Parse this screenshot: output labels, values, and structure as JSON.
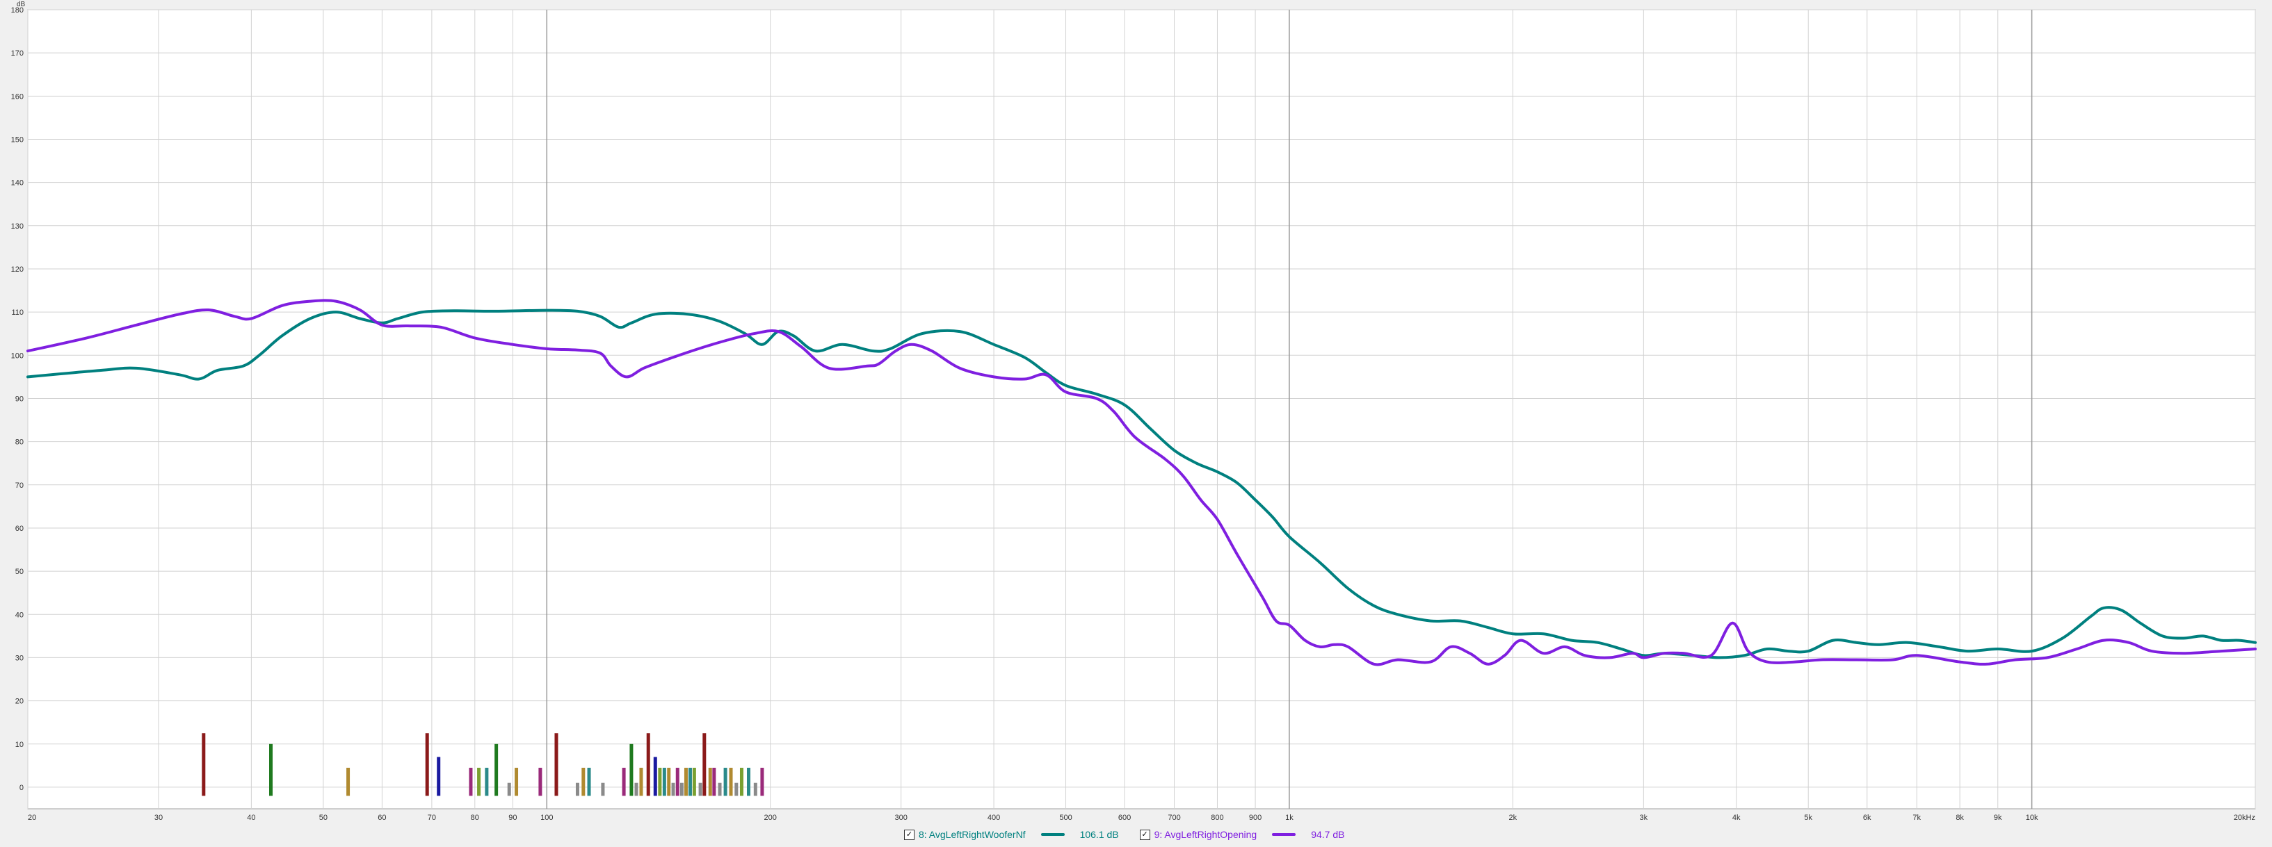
{
  "chart_data": {
    "type": "line",
    "title": "",
    "xlabel": "",
    "ylabel": "dB",
    "x_scale": "log",
    "xlim": [
      20,
      20000
    ],
    "ylim": [
      -5,
      180
    ],
    "grid": true,
    "y_ticks": [
      0,
      10,
      20,
      30,
      40,
      50,
      60,
      70,
      80,
      90,
      100,
      110,
      120,
      130,
      140,
      150,
      160,
      170,
      180
    ],
    "x_ticks": [
      {
        "value": 20,
        "label": "20"
      },
      {
        "value": 30,
        "label": "30"
      },
      {
        "value": 40,
        "label": "40"
      },
      {
        "value": 50,
        "label": "50"
      },
      {
        "value": 60,
        "label": "60"
      },
      {
        "value": 70,
        "label": "70"
      },
      {
        "value": 80,
        "label": "80"
      },
      {
        "value": 90,
        "label": "90"
      },
      {
        "value": 100,
        "label": "100"
      },
      {
        "value": 200,
        "label": "200"
      },
      {
        "value": 300,
        "label": "300"
      },
      {
        "value": 400,
        "label": "400"
      },
      {
        "value": 500,
        "label": "500"
      },
      {
        "value": 600,
        "label": "600"
      },
      {
        "value": 700,
        "label": "700"
      },
      {
        "value": 800,
        "label": "800"
      },
      {
        "value": 900,
        "label": "900"
      },
      {
        "value": 1000,
        "label": "1k"
      },
      {
        "value": 2000,
        "label": "2k"
      },
      {
        "value": 3000,
        "label": "3k"
      },
      {
        "value": 4000,
        "label": "4k"
      },
      {
        "value": 5000,
        "label": "5k"
      },
      {
        "value": 6000,
        "label": "6k"
      },
      {
        "value": 7000,
        "label": "7k"
      },
      {
        "value": 8000,
        "label": "8k"
      },
      {
        "value": 9000,
        "label": "9k"
      },
      {
        "value": 10000,
        "label": "10k"
      },
      {
        "value": 20000,
        "label": "20kHz"
      }
    ],
    "series": [
      {
        "name": "8: AvgLeftRightWooferNf",
        "level": "106.1 dB",
        "color": "#00807f",
        "points": [
          [
            20,
            95
          ],
          [
            25,
            96.5
          ],
          [
            28,
            97
          ],
          [
            32,
            95.5
          ],
          [
            34,
            94.5
          ],
          [
            36,
            96.5
          ],
          [
            39,
            97.5
          ],
          [
            41,
            100
          ],
          [
            44,
            104.5
          ],
          [
            48,
            108.5
          ],
          [
            52,
            110
          ],
          [
            56,
            108.5
          ],
          [
            60,
            107.5
          ],
          [
            63,
            108.5
          ],
          [
            68,
            110
          ],
          [
            75,
            110.3
          ],
          [
            85,
            110.2
          ],
          [
            100,
            110.4
          ],
          [
            110,
            110.2
          ],
          [
            118,
            109
          ],
          [
            125,
            106.5
          ],
          [
            130,
            107.5
          ],
          [
            140,
            109.5
          ],
          [
            155,
            109.5
          ],
          [
            170,
            108
          ],
          [
            185,
            105
          ],
          [
            195,
            102.5
          ],
          [
            205,
            105.5
          ],
          [
            215,
            104.5
          ],
          [
            230,
            101
          ],
          [
            250,
            102.5
          ],
          [
            275,
            101
          ],
          [
            290,
            101.5
          ],
          [
            320,
            105
          ],
          [
            360,
            105.5
          ],
          [
            400,
            102.5
          ],
          [
            440,
            99.5
          ],
          [
            470,
            96
          ],
          [
            500,
            93
          ],
          [
            550,
            91
          ],
          [
            600,
            88.5
          ],
          [
            650,
            83
          ],
          [
            700,
            78
          ],
          [
            750,
            75
          ],
          [
            800,
            73
          ],
          [
            850,
            70.5
          ],
          [
            900,
            66.5
          ],
          [
            950,
            62.5
          ],
          [
            1000,
            58
          ],
          [
            1100,
            52
          ],
          [
            1200,
            46
          ],
          [
            1300,
            42
          ],
          [
            1400,
            40
          ],
          [
            1550,
            38.5
          ],
          [
            1700,
            38.5
          ],
          [
            1850,
            37
          ],
          [
            2000,
            35.5
          ],
          [
            2200,
            35.5
          ],
          [
            2400,
            34
          ],
          [
            2600,
            33.5
          ],
          [
            2800,
            32
          ],
          [
            3000,
            30.5
          ],
          [
            3200,
            31
          ],
          [
            3500,
            30.5
          ],
          [
            3800,
            30
          ],
          [
            4100,
            30.5
          ],
          [
            4400,
            32
          ],
          [
            4700,
            31.5
          ],
          [
            5000,
            31.5
          ],
          [
            5400,
            34
          ],
          [
            5800,
            33.5
          ],
          [
            6200,
            33
          ],
          [
            6800,
            33.5
          ],
          [
            7500,
            32.5
          ],
          [
            8200,
            31.5
          ],
          [
            9000,
            32
          ],
          [
            10000,
            31.5
          ],
          [
            11000,
            34.5
          ],
          [
            12000,
            39.5
          ],
          [
            12500,
            41.5
          ],
          [
            13200,
            41
          ],
          [
            14000,
            38
          ],
          [
            15000,
            35
          ],
          [
            16000,
            34.5
          ],
          [
            17000,
            35
          ],
          [
            18000,
            34
          ],
          [
            19000,
            34
          ],
          [
            20000,
            33.5
          ]
        ]
      },
      {
        "name": "9: AvgLeftRightOpening",
        "level": "94.7 dB",
        "color": "#7f1fe0",
        "points": [
          [
            20,
            101
          ],
          [
            24,
            104
          ],
          [
            28,
            107
          ],
          [
            32,
            109.5
          ],
          [
            35,
            110.5
          ],
          [
            38,
            109
          ],
          [
            40,
            108.5
          ],
          [
            44,
            111.5
          ],
          [
            48,
            112.5
          ],
          [
            52,
            112.5
          ],
          [
            56,
            110.5
          ],
          [
            60,
            107
          ],
          [
            65,
            106.8
          ],
          [
            72,
            106.5
          ],
          [
            80,
            104
          ],
          [
            90,
            102.5
          ],
          [
            100,
            101.5
          ],
          [
            110,
            101.2
          ],
          [
            118,
            100.5
          ],
          [
            122,
            97.5
          ],
          [
            128,
            95
          ],
          [
            135,
            97
          ],
          [
            145,
            99
          ],
          [
            160,
            101.5
          ],
          [
            175,
            103.5
          ],
          [
            190,
            105
          ],
          [
            205,
            105.5
          ],
          [
            220,
            102
          ],
          [
            240,
            97
          ],
          [
            270,
            97.5
          ],
          [
            280,
            98
          ],
          [
            295,
            101
          ],
          [
            310,
            102.5
          ],
          [
            330,
            101
          ],
          [
            360,
            97
          ],
          [
            400,
            95
          ],
          [
            440,
            94.5
          ],
          [
            470,
            95.5
          ],
          [
            500,
            91.5
          ],
          [
            550,
            90
          ],
          [
            580,
            87
          ],
          [
            620,
            81
          ],
          [
            680,
            76
          ],
          [
            720,
            72
          ],
          [
            760,
            66.5
          ],
          [
            800,
            62
          ],
          [
            850,
            54
          ],
          [
            920,
            44
          ],
          [
            960,
            38.5
          ],
          [
            1000,
            37.5
          ],
          [
            1050,
            34
          ],
          [
            1100,
            32.5
          ],
          [
            1150,
            33
          ],
          [
            1200,
            32.5
          ],
          [
            1300,
            28.5
          ],
          [
            1400,
            29.5
          ],
          [
            1550,
            29
          ],
          [
            1650,
            32.5
          ],
          [
            1750,
            31
          ],
          [
            1850,
            28.5
          ],
          [
            1950,
            30.5
          ],
          [
            2050,
            34
          ],
          [
            2200,
            31
          ],
          [
            2350,
            32.5
          ],
          [
            2500,
            30.5
          ],
          [
            2700,
            30
          ],
          [
            2900,
            31
          ],
          [
            3000,
            30
          ],
          [
            3200,
            31
          ],
          [
            3400,
            31
          ],
          [
            3700,
            30.5
          ],
          [
            3950,
            38
          ],
          [
            4150,
            31.5
          ],
          [
            4400,
            29
          ],
          [
            4800,
            29
          ],
          [
            5200,
            29.5
          ],
          [
            5800,
            29.5
          ],
          [
            6500,
            29.5
          ],
          [
            7000,
            30.5
          ],
          [
            8000,
            29
          ],
          [
            8700,
            28.5
          ],
          [
            9500,
            29.5
          ],
          [
            10500,
            30
          ],
          [
            11500,
            32
          ],
          [
            12500,
            34
          ],
          [
            13500,
            33.5
          ],
          [
            14500,
            31.5
          ],
          [
            16000,
            31
          ],
          [
            18000,
            31.5
          ],
          [
            20000,
            32
          ]
        ]
      }
    ],
    "marker_bars": [
      {
        "freq": 34.5,
        "value": 12.5,
        "color": "#8b1a1a"
      },
      {
        "freq": 42.5,
        "value": 10,
        "color": "#1f7a1f"
      },
      {
        "freq": 54,
        "value": 4.5,
        "color": "#b08a30"
      },
      {
        "freq": 69,
        "value": 12.5,
        "color": "#8b1a1a"
      },
      {
        "freq": 71.5,
        "value": 7,
        "color": "#1a1aa0"
      },
      {
        "freq": 79,
        "value": 4.5,
        "color": "#9a2a7a"
      },
      {
        "freq": 81,
        "value": 4.5,
        "color": "#7aa030"
      },
      {
        "freq": 83,
        "value": 4.5,
        "color": "#2a8a8a"
      },
      {
        "freq": 85.5,
        "value": 10,
        "color": "#1f7a1f"
      },
      {
        "freq": 89,
        "value": 1,
        "color": "#8a8a8a"
      },
      {
        "freq": 91,
        "value": 4.5,
        "color": "#b08a30"
      },
      {
        "freq": 98,
        "value": 4.5,
        "color": "#9a2a7a"
      },
      {
        "freq": 103,
        "value": 12.5,
        "color": "#8b1a1a"
      },
      {
        "freq": 110,
        "value": 1,
        "color": "#8a8a8a"
      },
      {
        "freq": 112,
        "value": 4.5,
        "color": "#b08a30"
      },
      {
        "freq": 114,
        "value": 4.5,
        "color": "#2a8a8a"
      },
      {
        "freq": 119,
        "value": 1,
        "color": "#8a8a8a"
      },
      {
        "freq": 127,
        "value": 4.5,
        "color": "#9a2a7a"
      },
      {
        "freq": 130,
        "value": 10,
        "color": "#1f7a1f"
      },
      {
        "freq": 132,
        "value": 1,
        "color": "#8a8a8a"
      },
      {
        "freq": 134,
        "value": 4.5,
        "color": "#b08a30"
      },
      {
        "freq": 137,
        "value": 12.5,
        "color": "#8b1a1a"
      },
      {
        "freq": 140,
        "value": 7,
        "color": "#1a1aa0"
      },
      {
        "freq": 142,
        "value": 4.5,
        "color": "#7aa030"
      },
      {
        "freq": 144,
        "value": 4.5,
        "color": "#2a8a8a"
      },
      {
        "freq": 146,
        "value": 4.5,
        "color": "#b08a30"
      },
      {
        "freq": 148,
        "value": 1,
        "color": "#8a8a8a"
      },
      {
        "freq": 150,
        "value": 4.5,
        "color": "#9a2a7a"
      },
      {
        "freq": 152,
        "value": 1,
        "color": "#8a8a8a"
      },
      {
        "freq": 154,
        "value": 4.5,
        "color": "#b08a30"
      },
      {
        "freq": 156,
        "value": 4.5,
        "color": "#2a8a8a"
      },
      {
        "freq": 158,
        "value": 4.5,
        "color": "#7aa030"
      },
      {
        "freq": 161,
        "value": 1,
        "color": "#8a8a8a"
      },
      {
        "freq": 163,
        "value": 12.5,
        "color": "#8b1a1a"
      },
      {
        "freq": 166,
        "value": 4.5,
        "color": "#b08a30"
      },
      {
        "freq": 168,
        "value": 4.5,
        "color": "#9a2a7a"
      },
      {
        "freq": 171,
        "value": 1,
        "color": "#8a8a8a"
      },
      {
        "freq": 174,
        "value": 4.5,
        "color": "#2a8a8a"
      },
      {
        "freq": 177,
        "value": 4.5,
        "color": "#b08a30"
      },
      {
        "freq": 180,
        "value": 1,
        "color": "#8a8a8a"
      },
      {
        "freq": 183,
        "value": 4.5,
        "color": "#7aa030"
      },
      {
        "freq": 187,
        "value": 4.5,
        "color": "#2a8a8a"
      },
      {
        "freq": 191,
        "value": 1,
        "color": "#8a8a8a"
      },
      {
        "freq": 195,
        "value": 4.5,
        "color": "#9a2a7a"
      }
    ]
  },
  "legend": {
    "check_symbol": "✓"
  }
}
